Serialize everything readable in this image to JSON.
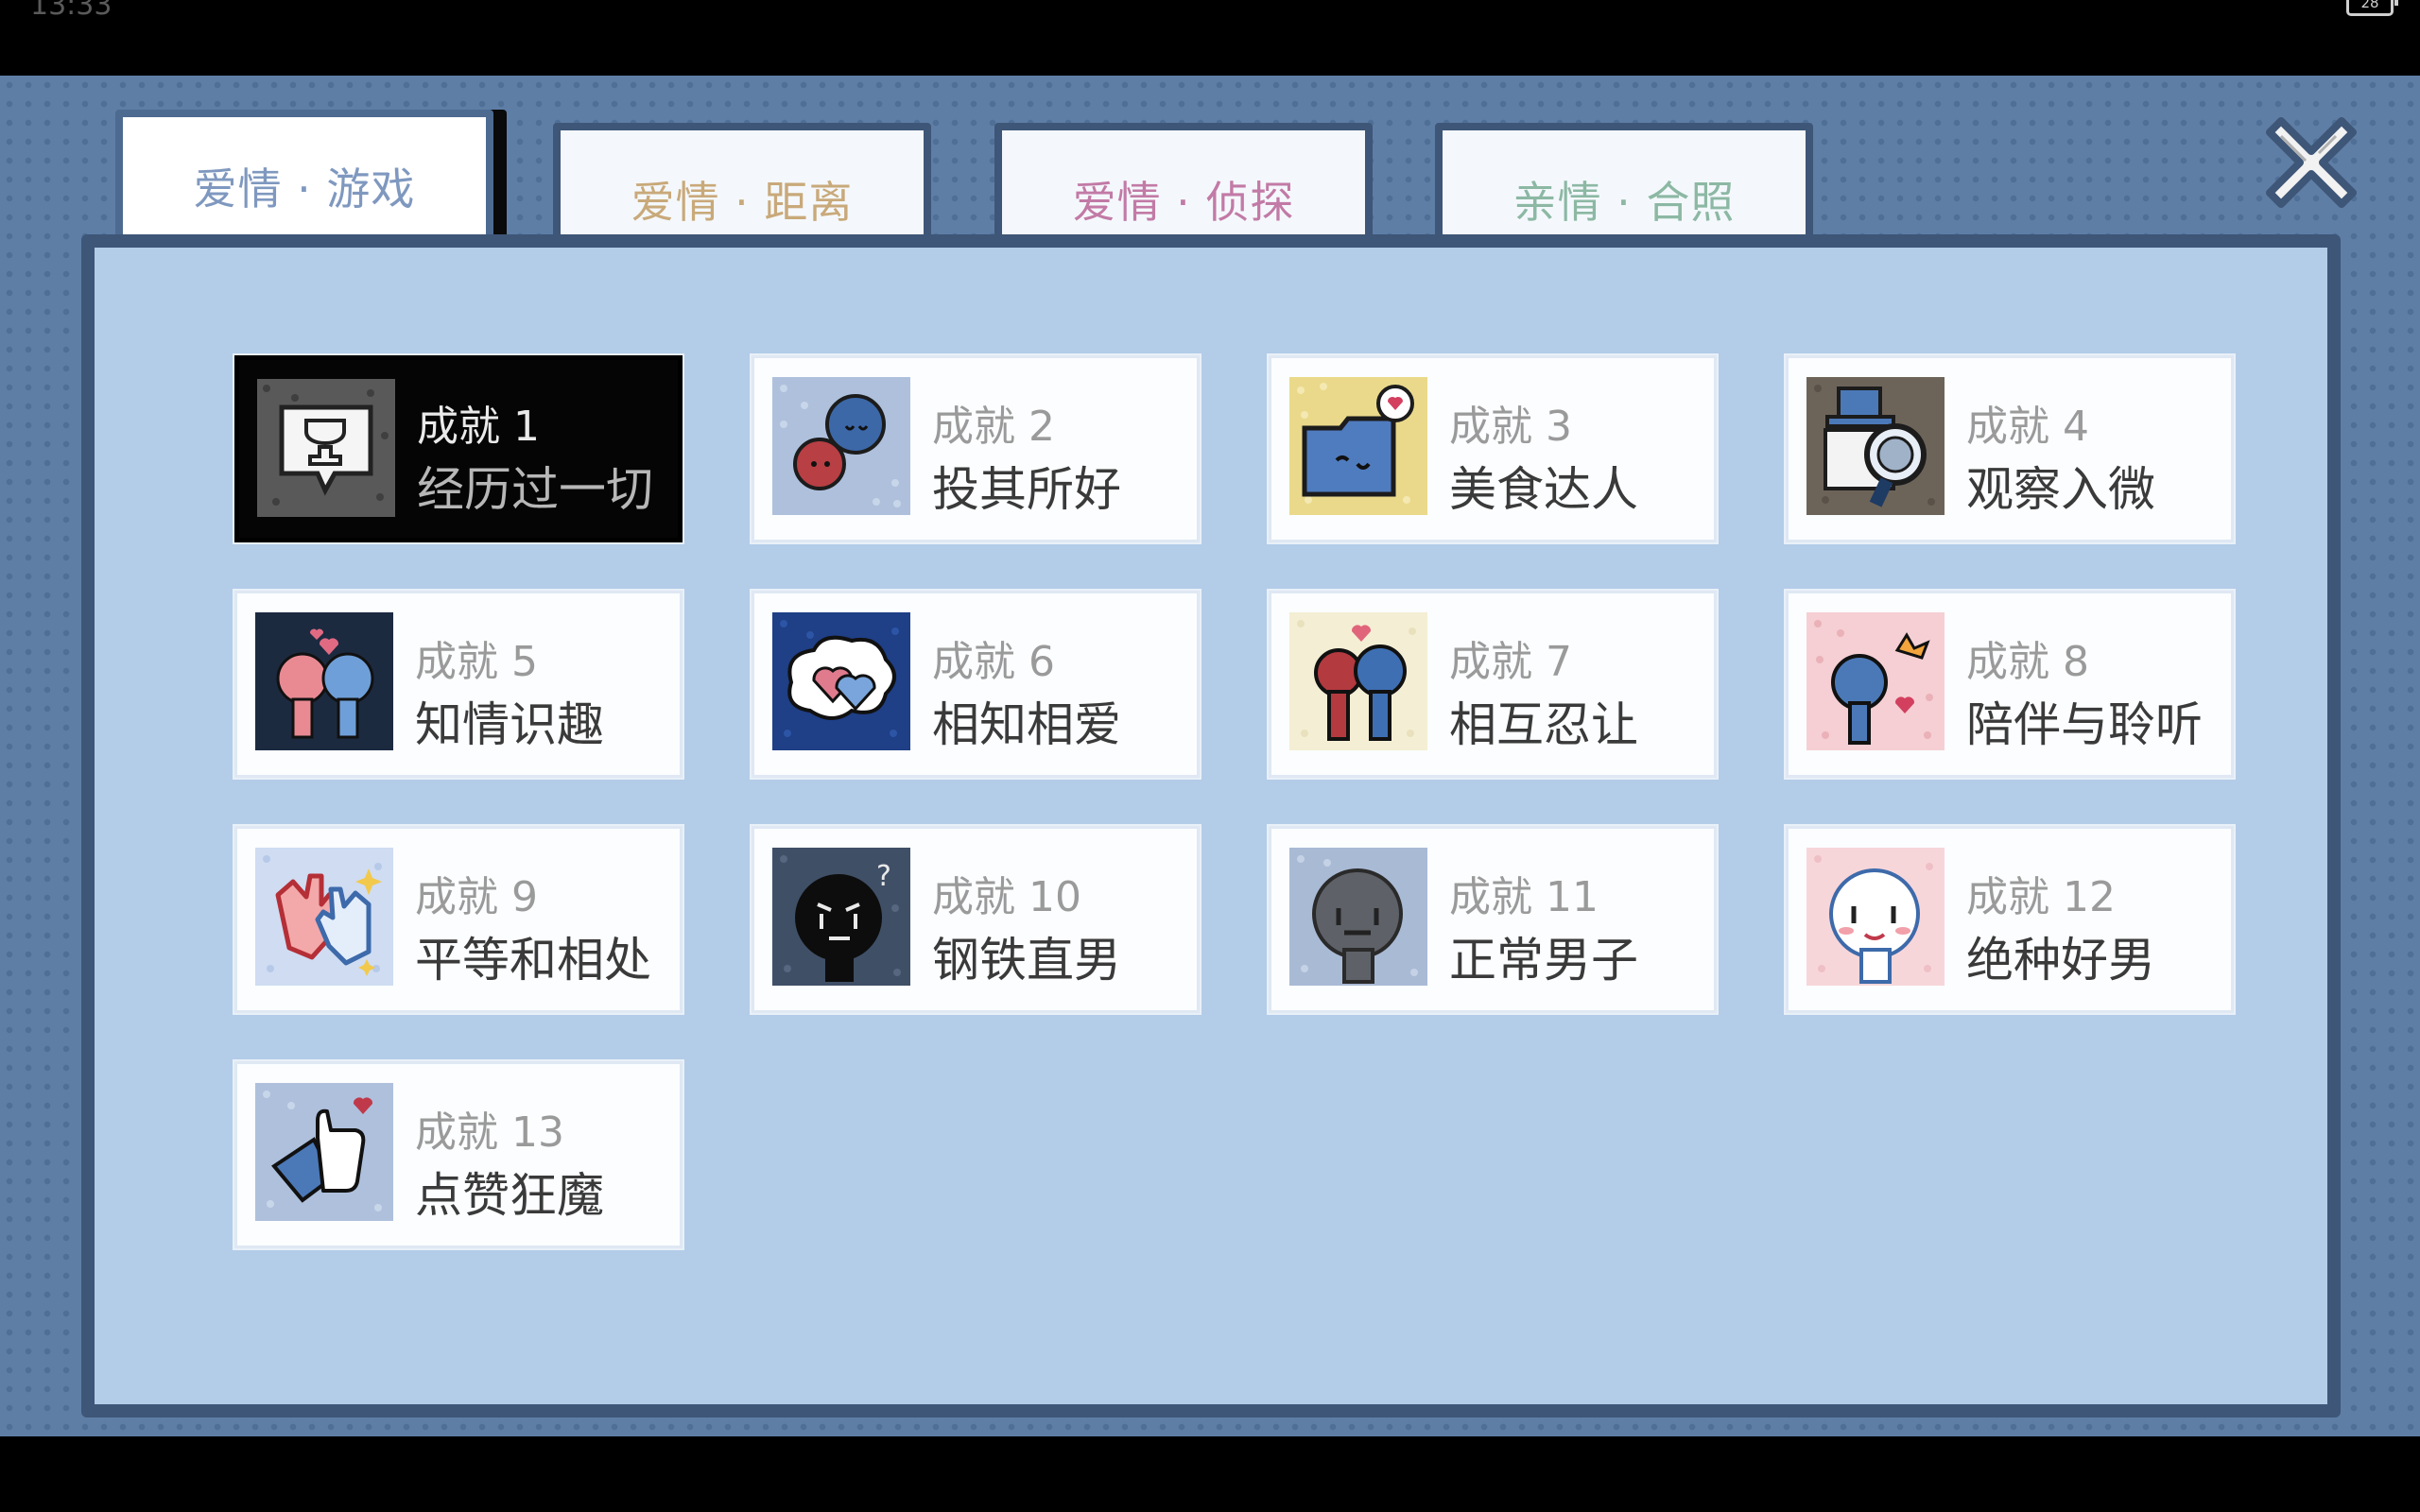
{
  "status_bar": {
    "time": "13:33",
    "battery": "28"
  },
  "tabs": [
    {
      "label": "爱情 · 游戏",
      "color": "#7f98bf",
      "active": true
    },
    {
      "label": "爱情 · 距离",
      "color": "#c9a97a",
      "active": false
    },
    {
      "label": "爱情 · 侦探",
      "color": "#c27aa6",
      "active": false
    },
    {
      "label": "亲情 · 合照",
      "color": "#8cb8a4",
      "active": false
    }
  ],
  "close_icon": "close-x-icon",
  "achievements": [
    {
      "num": "成就 1",
      "name": "经历过一切",
      "icon": "trophy-bubble-icon",
      "selected": true
    },
    {
      "num": "成就 2",
      "name": "投其所好",
      "icon": "speech-bubbles-icon"
    },
    {
      "num": "成就 3",
      "name": "美食达人",
      "icon": "folder-heart-icon"
    },
    {
      "num": "成就 4",
      "name": "观察入微",
      "icon": "detective-magnifier-icon"
    },
    {
      "num": "成就 5",
      "name": "知情识趣",
      "icon": "couple-hearts-icon"
    },
    {
      "num": "成就 6",
      "name": "相知相爱",
      "icon": "double-hearts-icon"
    },
    {
      "num": "成就 7",
      "name": "相互忍让",
      "icon": "couple-lean-icon"
    },
    {
      "num": "成就 8",
      "name": "陪伴与聆听",
      "icon": "listening-icon"
    },
    {
      "num": "成就 9",
      "name": "平等和相处",
      "icon": "high-five-icon"
    },
    {
      "num": "成就 10",
      "name": "钢铁直男",
      "icon": "black-face-icon"
    },
    {
      "num": "成就 11",
      "name": "正常男子",
      "icon": "grey-face-icon"
    },
    {
      "num": "成就 12",
      "name": "绝种好男",
      "icon": "white-face-icon"
    },
    {
      "num": "成就 13",
      "name": "点赞狂魔",
      "icon": "thumbs-up-icon"
    }
  ],
  "colors": {
    "background": "#5e7ea6",
    "panel": "#b3cce8",
    "border": "#3e5677"
  }
}
